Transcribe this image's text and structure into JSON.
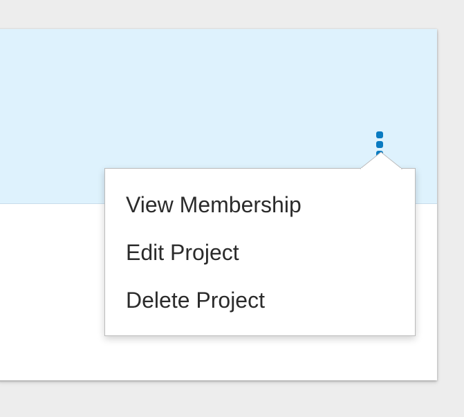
{
  "card": {
    "header_color": "#def2fd",
    "actions_icon": "kebab-vertical-icon",
    "accent_color": "#0a7bc1"
  },
  "dropdown": {
    "items": [
      {
        "label": "View Membership"
      },
      {
        "label": "Edit Project"
      },
      {
        "label": "Delete Project"
      }
    ]
  }
}
